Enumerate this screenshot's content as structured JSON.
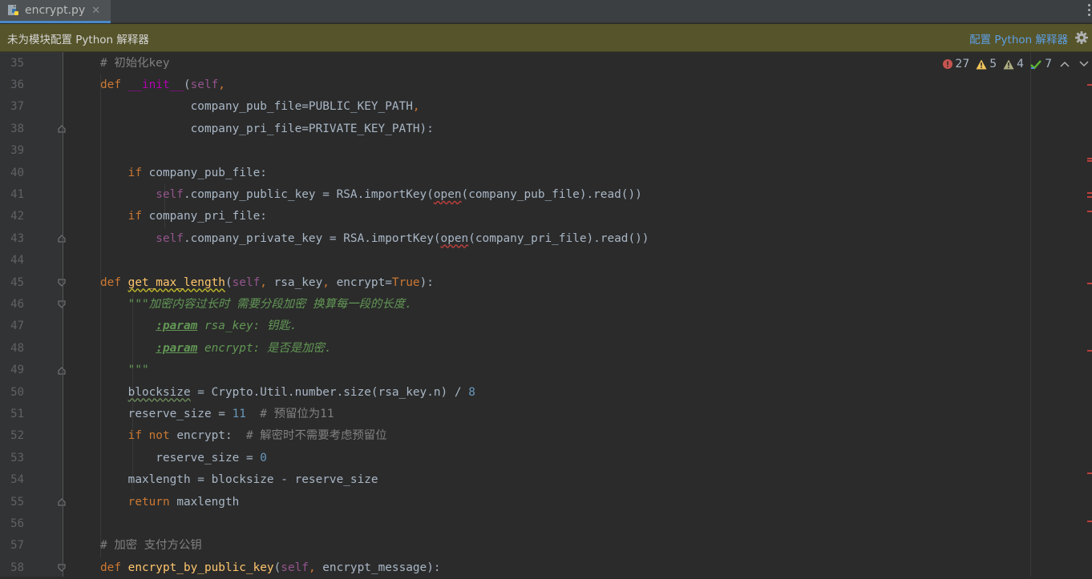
{
  "tab": {
    "name": "encrypt.py"
  },
  "banner": {
    "message": "未为模块配置 Python 解释器",
    "action": "配置 Python 解释器"
  },
  "inspections": {
    "errors": "27",
    "warnings": "5",
    "weak_warnings": "4",
    "ok": "7"
  },
  "colors": {
    "background": "#2b2b2b",
    "gutter": "#313335",
    "banner": "#56542a",
    "link": "#5e9fe5",
    "keyword": "#cc7832",
    "self": "#94558d",
    "function": "#ffc66d",
    "magic": "#b200b2",
    "number": "#6897bb",
    "comment": "#808080",
    "docstring": "#629755",
    "text": "#a9b7c6",
    "error": "#bc3f3c"
  },
  "icons": [
    "python-file-icon",
    "close-icon",
    "gear-icon",
    "error-icon",
    "warning-icon",
    "weak-warning-icon",
    "check-icon",
    "chevron-up-icon",
    "chevron-down-icon",
    "fold-icon"
  ],
  "lines": [
    {
      "n": "35",
      "tokens": [
        {
          "t": "# 初始化key",
          "c": "cm"
        }
      ]
    },
    {
      "n": "36",
      "tokens": [
        {
          "t": "def ",
          "c": "kw"
        },
        {
          "t": "__init__",
          "c": "magic"
        },
        {
          "t": "(",
          "c": "tx"
        },
        {
          "t": "self",
          "c": "self"
        },
        {
          "t": ",",
          "c": "kw"
        }
      ]
    },
    {
      "n": "37",
      "tokens": [
        {
          "t": "             company_pub_file=PUBLIC_KEY_PATH",
          "c": "tx"
        },
        {
          "t": ",",
          "c": "kw"
        }
      ]
    },
    {
      "n": "38",
      "tokens": [
        {
          "t": "             company_pri_file=PRIVATE_KEY_PATH):",
          "c": "tx"
        }
      ]
    },
    {
      "n": "39",
      "tokens": []
    },
    {
      "n": "40",
      "tokens": [
        {
          "t": "    if ",
          "c": "kw"
        },
        {
          "t": "company_pub_file:",
          "c": "tx"
        }
      ]
    },
    {
      "n": "41",
      "tokens": [
        {
          "t": "        self",
          "c": "self"
        },
        {
          "t": ".company_public_key = RSA.importKey(",
          "c": "tx"
        },
        {
          "t": "open",
          "c": "tx wavy"
        },
        {
          "t": "(company_pub_file).read())",
          "c": "tx"
        }
      ]
    },
    {
      "n": "42",
      "tokens": [
        {
          "t": "    if ",
          "c": "kw"
        },
        {
          "t": "company_pri_file:",
          "c": "tx"
        }
      ]
    },
    {
      "n": "43",
      "tokens": [
        {
          "t": "        self",
          "c": "self"
        },
        {
          "t": ".company_private_key = RSA.importKey(",
          "c": "tx"
        },
        {
          "t": "open",
          "c": "tx wavy"
        },
        {
          "t": "(company_pri_file).read())",
          "c": "tx"
        }
      ]
    },
    {
      "n": "44",
      "tokens": []
    },
    {
      "n": "45",
      "tokens": [
        {
          "t": "def ",
          "c": "kw"
        },
        {
          "t": "get_max_length",
          "c": "fnu"
        },
        {
          "t": "(",
          "c": "tx"
        },
        {
          "t": "self",
          "c": "self"
        },
        {
          "t": ", ",
          "c": "kw"
        },
        {
          "t": "rsa_key",
          "c": "tx"
        },
        {
          "t": ", ",
          "c": "kw"
        },
        {
          "t": "encrypt=",
          "c": "tx"
        },
        {
          "t": "True",
          "c": "kw"
        },
        {
          "t": "):",
          "c": "tx"
        }
      ]
    },
    {
      "n": "46",
      "tokens": [
        {
          "t": "    \"\"\"加密内容过长时 需要分段加密 换算每一段的长度.",
          "c": "doc"
        }
      ]
    },
    {
      "n": "47",
      "tokens": [
        {
          "t": "        ",
          "c": "doc"
        },
        {
          "t": ":param",
          "c": "dt"
        },
        {
          "t": " rsa_key: 钥匙.",
          "c": "doc"
        }
      ]
    },
    {
      "n": "48",
      "tokens": [
        {
          "t": "        ",
          "c": "doc"
        },
        {
          "t": ":param",
          "c": "dt"
        },
        {
          "t": " encrypt: 是否是加密.",
          "c": "doc"
        }
      ]
    },
    {
      "n": "49",
      "tokens": [
        {
          "t": "    \"\"\"",
          "c": "doc"
        }
      ]
    },
    {
      "n": "50",
      "tokens": [
        {
          "t": "    ",
          "c": "tx"
        },
        {
          "t": "blocksize",
          "c": "tx wavyg"
        },
        {
          "t": " = Crypto.Util.number.size(rsa_key.n) / ",
          "c": "tx"
        },
        {
          "t": "8",
          "c": "num"
        }
      ]
    },
    {
      "n": "51",
      "tokens": [
        {
          "t": "    reserve_size = ",
          "c": "tx"
        },
        {
          "t": "11",
          "c": "num"
        },
        {
          "t": "  # 预留位为11",
          "c": "cm"
        }
      ]
    },
    {
      "n": "52",
      "tokens": [
        {
          "t": "    if not ",
          "c": "kw"
        },
        {
          "t": "encrypt:",
          "c": "tx"
        },
        {
          "t": "  # 解密时不需要考虑预留位",
          "c": "cm"
        }
      ]
    },
    {
      "n": "53",
      "tokens": [
        {
          "t": "        reserve_size = ",
          "c": "tx"
        },
        {
          "t": "0",
          "c": "num"
        }
      ]
    },
    {
      "n": "54",
      "tokens": [
        {
          "t": "    maxlength = blocksize - reserve_size",
          "c": "tx"
        }
      ]
    },
    {
      "n": "55",
      "tokens": [
        {
          "t": "    return ",
          "c": "kw"
        },
        {
          "t": "maxlength",
          "c": "tx"
        }
      ]
    },
    {
      "n": "56",
      "tokens": []
    },
    {
      "n": "57",
      "tokens": [
        {
          "t": "# 加密 支付方公钥",
          "c": "cm"
        }
      ]
    },
    {
      "n": "58",
      "tokens": [
        {
          "t": "def ",
          "c": "kw"
        },
        {
          "t": "encrypt_by_public_key",
          "c": "fn"
        },
        {
          "t": "(",
          "c": "tx"
        },
        {
          "t": "self",
          "c": "self"
        },
        {
          "t": ", ",
          "c": "kw"
        },
        {
          "t": "encrypt_message):",
          "c": "tx"
        }
      ]
    }
  ]
}
